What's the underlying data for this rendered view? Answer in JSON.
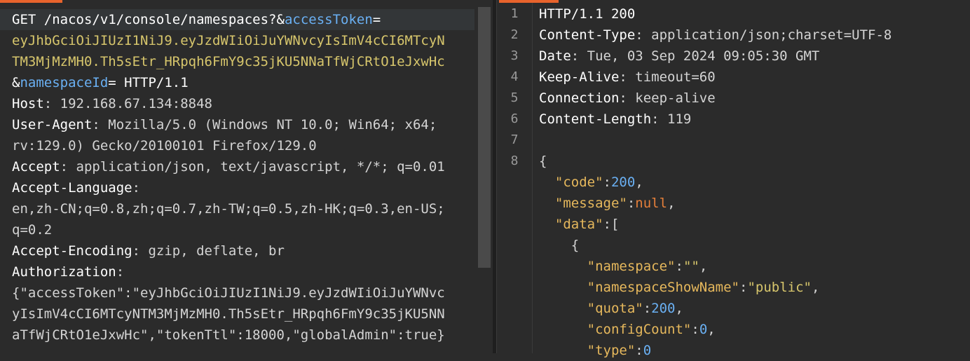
{
  "request": {
    "lines": [
      {
        "key": "GET /nacos/v1/console/namespaces?&",
        "link": "accessToken",
        "rest": "="
      },
      {
        "text": "eyJhbGciOiJIUzI1NiJ9.eyJzdWIiOiJuYWNvcyIsImV4cCI6MTcyN"
      },
      {
        "text": "TM3MjMzMH0.Th5sEtr_HRpqh6FmY9c35jKU5NNaTfWjCRtO1eJxwHc"
      },
      {
        "amp": "&",
        "link": "namespaceId",
        "rest": "= HTTP/1.1"
      },
      {
        "key": "Host",
        "value": ": 192.168.67.134:8848"
      },
      {
        "key": "User-Agent",
        "value": ": Mozilla/5.0 (Windows NT 10.0; Win64; x64;"
      },
      {
        "text": "rv:129.0) Gecko/20100101 Firefox/129.0"
      },
      {
        "key": "Accept",
        "value": ": application/json, text/javascript, */*; q=0.01"
      },
      {
        "key": "Accept-Language",
        "value": ":"
      },
      {
        "text": "en,zh-CN;q=0.8,zh;q=0.7,zh-TW;q=0.5,zh-HK;q=0.3,en-US;"
      },
      {
        "text": "q=0.2"
      },
      {
        "key": "Accept-Encoding",
        "value": ": gzip, deflate, br"
      },
      {
        "key": "Authorization",
        "value": ":"
      },
      {
        "text": "{\"accessToken\":\"eyJhbGciOiJIUzI1NiJ9.eyJzdWIiOiJuYWNvc"
      },
      {
        "text": "yIsImV4cCI6MTcyNTM3MjMzMH0.Th5sEtr_HRpqh6FmY9c35jKU5NN"
      },
      {
        "text": "aTfWjCRtO1eJxwHc\",\"tokenTtl\":18000,\"globalAdmin\":true}"
      }
    ]
  },
  "response": {
    "line_numbers": [
      "1",
      "2",
      "3",
      "4",
      "5",
      "6",
      "7",
      "8"
    ],
    "status_line": "HTTP/1.1 200",
    "headers": [
      {
        "key": "Content-Type",
        "value": ": application/json;charset=UTF-8"
      },
      {
        "key": "Date",
        "value": ": Tue, 03 Sep 2024 09:05:30 GMT"
      },
      {
        "key": "Keep-Alive",
        "value": ": timeout=60"
      },
      {
        "key": "Connection",
        "value": ": keep-alive"
      },
      {
        "key": "Content-Length",
        "value": ": 119"
      }
    ],
    "json_body": {
      "open_brace": "{",
      "code_key": "\"code\"",
      "code_val": "200",
      "message_key": "\"message\"",
      "message_val": "null",
      "data_key": "\"data\"",
      "data_open": "[",
      "item_open": "{",
      "namespace_key": "\"namespace\"",
      "namespace_val": "\"\"",
      "showname_key": "\"namespaceShowName\"",
      "showname_val": "\"public\"",
      "quota_key": "\"quota\"",
      "quota_val": "200",
      "configcount_key": "\"configCount\"",
      "configcount_val": "0",
      "type_key": "\"type\"",
      "type_val": "0"
    }
  },
  "colors": {
    "accent": "#e8632c",
    "json_key": "#e6b85c",
    "json_string": "#d7c66c",
    "json_number": "#6ab0f3",
    "json_null": "#e57f3a"
  }
}
